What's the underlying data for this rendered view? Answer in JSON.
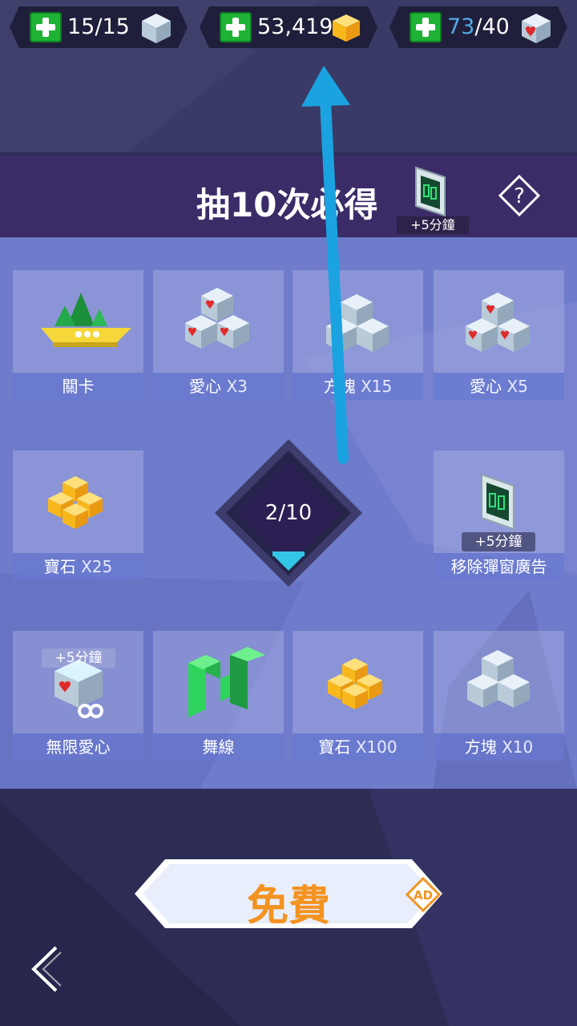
{
  "resources": {
    "cubes": {
      "value": "15/15",
      "icon": "cube-icon"
    },
    "gems": {
      "value": "53,419",
      "icon": "gem-icon"
    },
    "hearts": {
      "current": "73",
      "max": "/40",
      "icon": "heart-cube-icon"
    }
  },
  "banner": {
    "title": "抽10次必得",
    "reward_label": "+5分鐘",
    "help": "?"
  },
  "prizes": [
    {
      "label": "關卡",
      "qty": ""
    },
    {
      "label": "愛心",
      "qty": " X3"
    },
    {
      "label": "方塊",
      "qty": " X15"
    },
    {
      "label": "愛心",
      "qty": " X5"
    },
    {
      "label": "寶石",
      "qty": " X25"
    },
    {
      "label": "移除彈窗廣告",
      "qty": "",
      "tag": "+5分鐘"
    },
    {
      "label": "無限愛心",
      "qty": "",
      "tag": "+5分鐘"
    },
    {
      "label": "舞線",
      "qty": ""
    },
    {
      "label": "寶石",
      "qty": " X100"
    },
    {
      "label": "方塊",
      "qty": " X10"
    }
  ],
  "counter": {
    "text": "2/10"
  },
  "free_button": {
    "label": "免費",
    "badge": "AD"
  },
  "colors": {
    "accent_orange": "#f39320",
    "plus_green": "#1fb336",
    "arrow_blue": "#1aa3e0"
  }
}
